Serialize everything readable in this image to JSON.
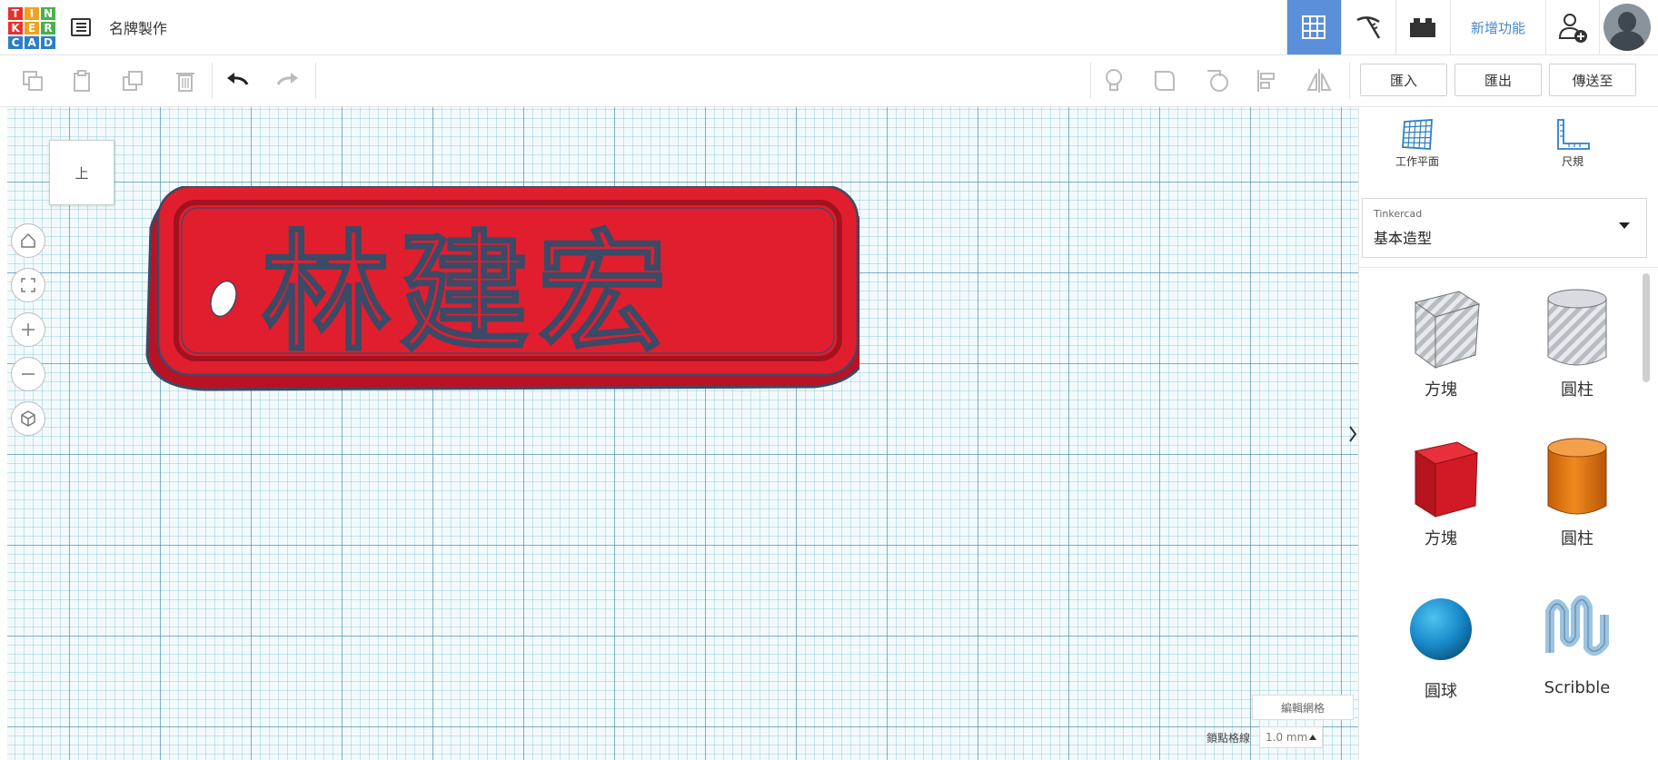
{
  "app": {
    "logo_letters": [
      "T",
      "I",
      "N",
      "K",
      "E",
      "R",
      "C",
      "A",
      "D"
    ],
    "logo_colors": [
      "#e9302a",
      "#f0a21b",
      "#47b14b",
      "#e9302a",
      "#f0a21b",
      "#47b14b",
      "#2c7fc6",
      "#2c7fc6",
      "#2c7fc6"
    ],
    "doc_title": "名牌製作"
  },
  "topbar": {
    "new_features": "新增功能",
    "active_color": "#5b8fd9",
    "link_color": "#4a86c8"
  },
  "toolbar": {
    "import_label": "匯入",
    "export_label": "匯出",
    "send_label": "傳送至"
  },
  "workplane": {
    "view_label": "上",
    "edit_grid_label": "編輯網格",
    "snap_label": "鎖點格線",
    "snap_value": "1.0 mm",
    "keychain_text": "林建宏",
    "keychain_color": "#e01e2e"
  },
  "panel": {
    "workplane_label": "工作平面",
    "ruler_label": "尺規",
    "library_source": "Tinkercad",
    "library_name": "基本造型",
    "shapes": [
      {
        "label": "方塊"
      },
      {
        "label": "圓柱"
      },
      {
        "label": "方塊"
      },
      {
        "label": "圓柱"
      },
      {
        "label": "圓球"
      },
      {
        "label": "Scribble"
      }
    ]
  }
}
